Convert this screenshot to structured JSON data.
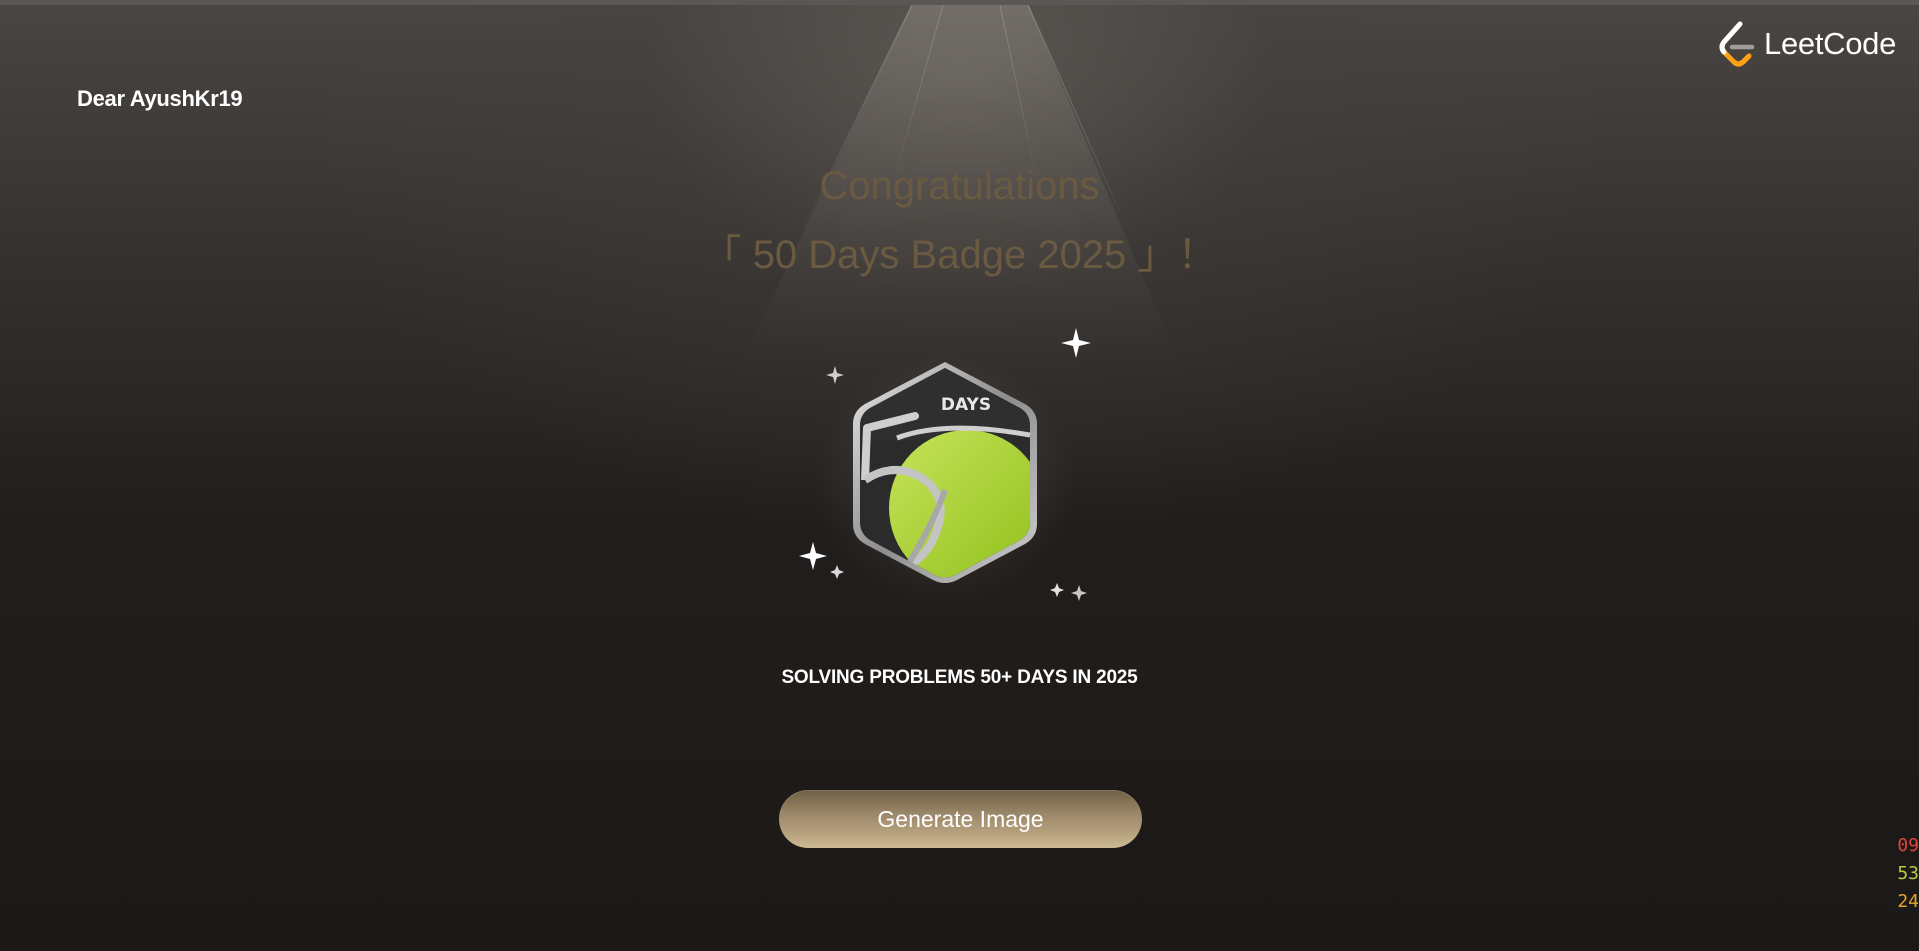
{
  "greeting": "Dear AyushKr19",
  "logo": {
    "text": "LeetCode",
    "accent": "#FFA116"
  },
  "congratulations": {
    "line1": "Congratulations",
    "line2": "「 50 Days Badge 2025 」！"
  },
  "badge": {
    "label": "DAYS",
    "number": "50",
    "accent_color": "#a8cf2a",
    "description": "SOLVING PROBLEMS 50+ DAYS IN 2025"
  },
  "actions": {
    "generate_label": "Generate Image"
  },
  "timer": [
    "09",
    "53",
    "24"
  ]
}
